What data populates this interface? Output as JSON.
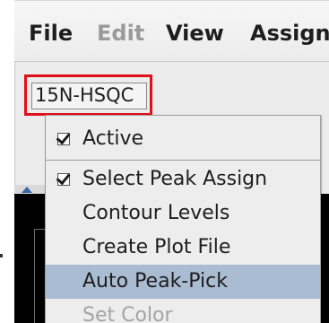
{
  "menubar": {
    "items": [
      {
        "label": "File",
        "enabled": true
      },
      {
        "label": "Edit",
        "enabled": false
      },
      {
        "label": "View",
        "enabled": true
      },
      {
        "label": "Assign",
        "enabled": true
      }
    ]
  },
  "spectrum_tab": {
    "label": "15N-HSQC",
    "highlight_color": "#e2101b"
  },
  "context_menu": {
    "items": [
      {
        "label": "Active",
        "checked": true
      },
      {
        "label": "Select Peak Assign",
        "checked": true
      },
      {
        "label": "Contour Levels"
      },
      {
        "label": "Create Plot File"
      },
      {
        "label": "Auto Peak-Pick",
        "highlighted": true
      },
      {
        "label": "Set Color",
        "enabled": false
      }
    ]
  },
  "colors": {
    "menu_highlight": "#a9bcd2",
    "plot_background": "#000000"
  }
}
